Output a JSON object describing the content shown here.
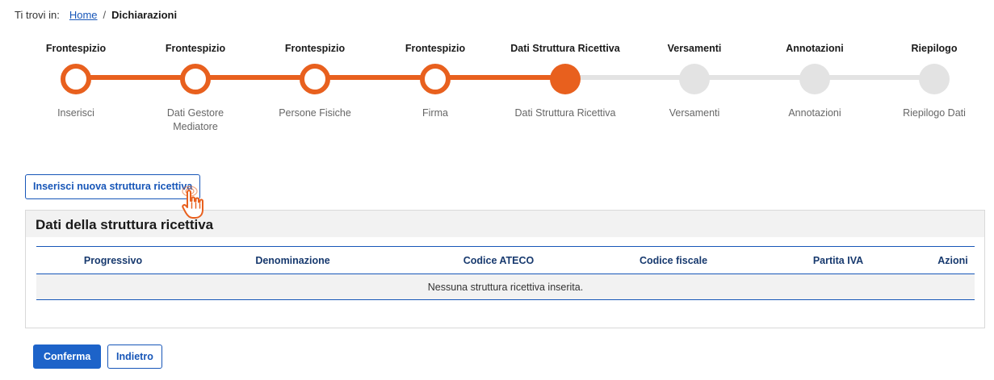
{
  "breadcrumb": {
    "prefix": "Ti trovi in:",
    "home": "Home",
    "separator": "/",
    "current": "Dichiarazioni"
  },
  "stepper": {
    "steps": [
      {
        "title": "Frontespizio",
        "subtitle": "Inserisci",
        "state": "done"
      },
      {
        "title": "Frontespizio",
        "subtitle": "Dati Gestore Mediatore",
        "state": "done"
      },
      {
        "title": "Frontespizio",
        "subtitle": "Persone Fisiche",
        "state": "done"
      },
      {
        "title": "Frontespizio",
        "subtitle": "Firma",
        "state": "done"
      },
      {
        "title": "Dati Struttura Ricettiva",
        "subtitle": "Dati Struttura Ricettiva",
        "state": "active"
      },
      {
        "title": "Versamenti",
        "subtitle": "Versamenti",
        "state": "todo"
      },
      {
        "title": "Annotazioni",
        "subtitle": "Annotazioni",
        "state": "todo"
      },
      {
        "title": "Riepilogo",
        "subtitle": "Riepilogo Dati",
        "state": "todo"
      }
    ],
    "colors": {
      "done": "#e8601e",
      "todo": "#e3e3e3"
    }
  },
  "actions": {
    "new_structure": "Inserisci nuova struttura ricettiva",
    "confirm": "Conferma",
    "back": "Indietro"
  },
  "panel": {
    "title": "Dati della struttura ricettiva",
    "columns": [
      "Progressivo",
      "Denominazione",
      "Codice ATECO",
      "Codice fiscale",
      "Partita IVA",
      "Azioni"
    ],
    "empty_message": "Nessuna struttura ricettiva inserita."
  },
  "icons": {
    "cursor": "hand-pointer-icon"
  }
}
